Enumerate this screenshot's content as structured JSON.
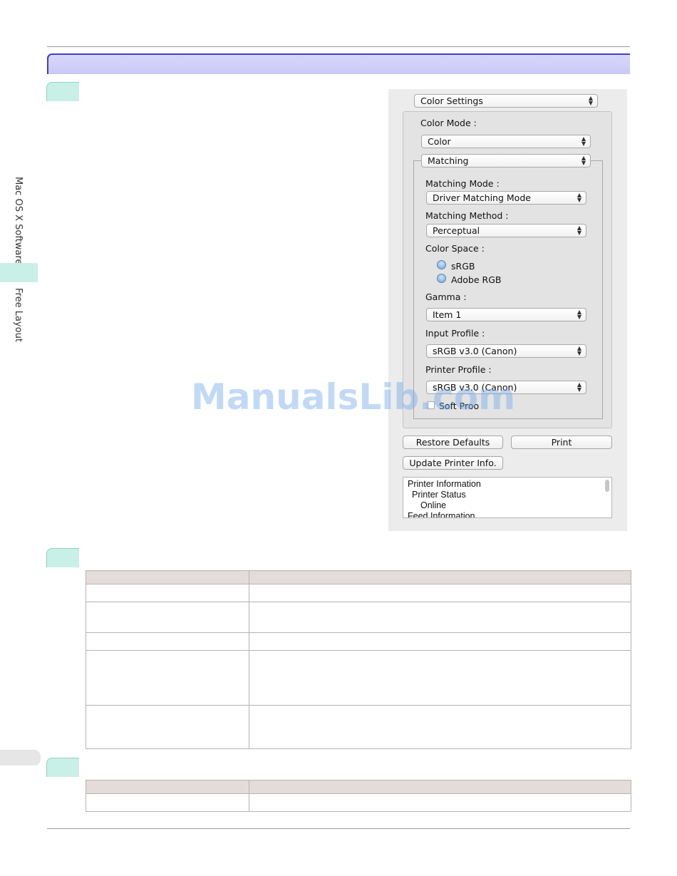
{
  "side_tabs": {
    "section": "Mac OS X Software",
    "subsection": "Free Layout"
  },
  "dialog": {
    "panel_selector": "Color Settings",
    "color_mode_label": "Color Mode :",
    "color_mode_value": "Color",
    "group_selector": "Matching",
    "matching_mode_label": "Matching Mode :",
    "matching_mode_value": "Driver Matching Mode",
    "matching_method_label": "Matching Method :",
    "matching_method_value": "Perceptual",
    "color_space_label": "Color Space :",
    "color_space_options": [
      "sRGB",
      "Adobe RGB"
    ],
    "gamma_label": "Gamma :",
    "gamma_value": "Item 1",
    "input_profile_label": "Input Profile :",
    "input_profile_value": "sRGB v3.0 (Canon)",
    "printer_profile_label": "Printer Profile :",
    "printer_profile_value": "sRGB v3.0 (Canon)",
    "soft_proof_label": "Soft Proo",
    "restore_defaults_label": "Restore Defaults",
    "print_label": "Print",
    "update_printer_info_label": "Update Printer Info.",
    "info_lines": [
      "Printer Information",
      "Printer Status",
      "Online",
      "Feed Information"
    ]
  },
  "watermark": "ManualsLib.com"
}
